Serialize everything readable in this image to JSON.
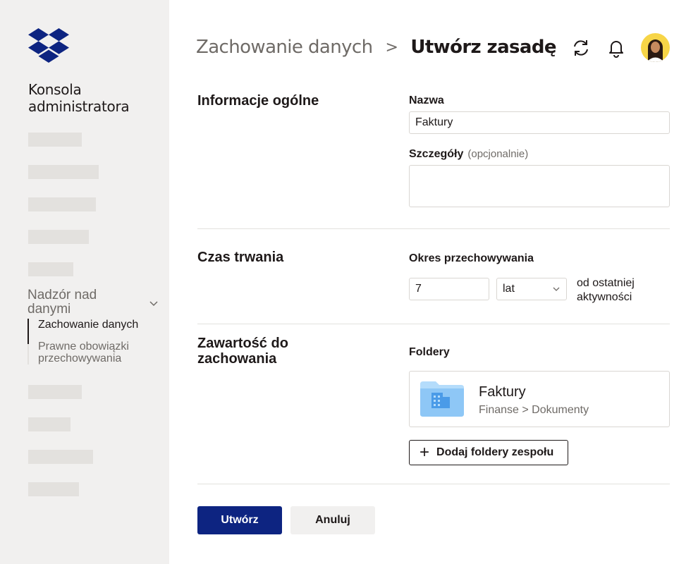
{
  "sidebar": {
    "title": "Konsola administratora",
    "nav_group": "Nadzór nad danymi",
    "subnav": [
      {
        "label": "Zachowanie danych"
      },
      {
        "label": "Prawne obowiązki przechowywania"
      }
    ]
  },
  "header": {
    "breadcrumb_parent": "Zachowanie danych",
    "breadcrumb_separator": ">",
    "breadcrumb_current": "Utwórz zasadę"
  },
  "general": {
    "section_title": "Informacje ogólne",
    "name_label": "Nazwa",
    "name_value": "Faktury",
    "details_label": "Szczegóły",
    "details_optional": "(opcjonalnie)",
    "details_value": ""
  },
  "duration": {
    "section_title": "Czas trwania",
    "period_label": "Okres przechowywania",
    "period_value": "7",
    "unit_value": "lat",
    "suffix": "od ostatniej aktywności"
  },
  "content": {
    "section_title": "Zawartość do zachowania",
    "folders_label": "Foldery",
    "folder": {
      "name": "Faktury",
      "path": "Finanse > Dokumenty"
    },
    "add_button": "Dodaj foldery zespołu"
  },
  "actions": {
    "create": "Utwórz",
    "cancel": "Anuluj"
  },
  "colors": {
    "primary": "#0d2481",
    "dropbox_blue": "#0d2481",
    "sidebar_bg": "#f1f0ef",
    "avatar_bg": "#f7d547"
  },
  "icons": [
    "dropbox-logo",
    "sync-icon",
    "bell-icon",
    "chevron-down-icon",
    "folder-icon",
    "plus-icon"
  ]
}
